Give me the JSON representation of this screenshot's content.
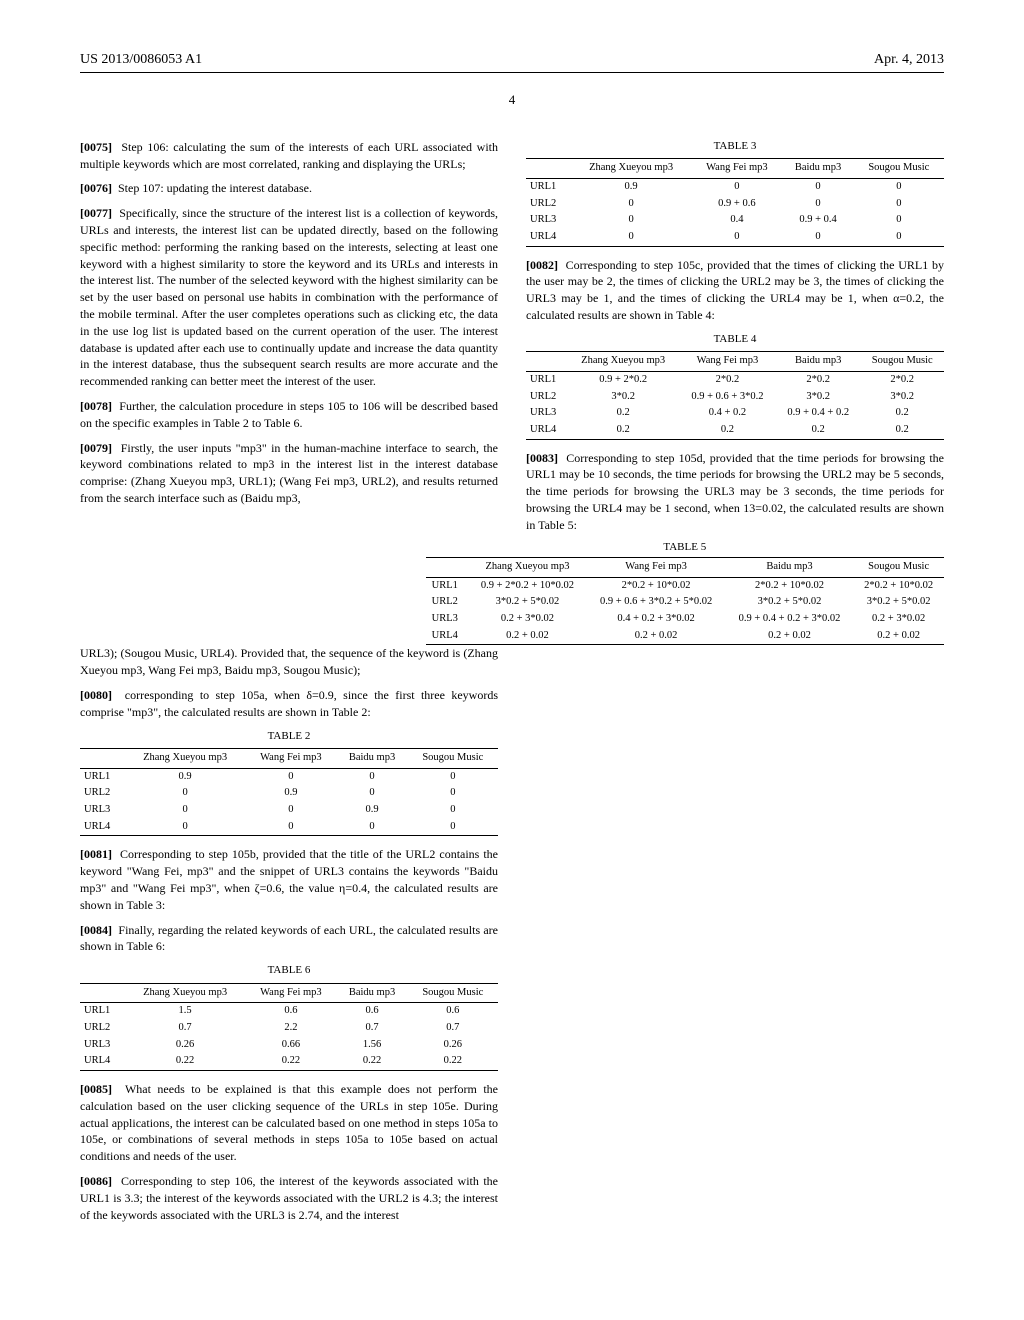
{
  "header": {
    "pubnum": "US 2013/0086053 A1",
    "date": "Apr. 4, 2013",
    "pagenum": "4"
  },
  "paras": {
    "p0075": {
      "num": "[0075]",
      "text": "Step 106: calculating the sum of the interests of each URL associated with multiple keywords which are most correlated, ranking and displaying the URLs;"
    },
    "p0076": {
      "num": "[0076]",
      "text": "Step 107: updating the interest database."
    },
    "p0077": {
      "num": "[0077]",
      "text": "Specifically, since the structure of the interest list is a collection of keywords, URLs and interests, the interest list can be updated directly, based on the following specific method: performing the ranking based on the interests, selecting at least one keyword with a highest similarity to store the keyword and its URLs and interests in the interest list. The number of the selected keyword with the highest similarity can be set by the user based on personal use habits in combination with the performance of the mobile terminal. After the user completes operations such as clicking etc, the data in the use log list is updated based on the current operation of the user. The interest database is updated after each use to continually update and increase the data quantity in the interest database, thus the subsequent search results are more accurate and the recommended ranking can better meet the interest of the user."
    },
    "p0078": {
      "num": "[0078]",
      "text": "Further, the calculation procedure in steps 105 to 106 will be described based on the specific examples in Table 2 to Table 6."
    },
    "p0079": {
      "num": "[0079]",
      "text": "Firstly, the user inputs \"mp3\" in the human-machine interface to search, the keyword combinations related to mp3 in the interest list in the interest database comprise: (Zhang Xueyou mp3, URL1); (Wang Fei mp3, URL2), and results returned from the search interface such as (Baidu mp3,"
    },
    "pCont": {
      "text": "URL3); (Sougou Music, URL4). Provided that, the sequence of the keyword is (Zhang Xueyou mp3, Wang Fei mp3, Baidu mp3, Sougou Music);"
    },
    "p0080": {
      "num": "[0080]",
      "text": "corresponding to step 105a, when δ=0.9, since the first three keywords comprise \"mp3\", the calculated results are shown in Table 2:"
    },
    "p0081": {
      "num": "[0081]",
      "text": "Corresponding to step 105b, provided that the title of the URL2 contains the keyword \"Wang Fei, mp3\" and the snippet of URL3 contains the keywords \"Baidu mp3\" and \"Wang Fei mp3\", when ζ=0.6, the value η=0.4, the calculated results are shown in Table 3:"
    },
    "p0082": {
      "num": "[0082]",
      "text": "Corresponding to step 105c, provided that the times of clicking the URL1 by the user may be 2, the times of clicking the URL2 may be 3, the times of clicking the URL3 may be 1, and the times of clicking the URL4 may be 1, when α=0.2, the calculated results are shown in Table 4:"
    },
    "p0083": {
      "num": "[0083]",
      "text": "Corresponding to step 105d, provided that the time periods for browsing the URL1 may be 10 seconds, the time periods for browsing the URL2 may be 5 seconds, the time periods for browsing the URL3 may be 3 seconds, the time periods for browsing the URL4 may be 1 second, when 13=0.02, the calculated results are shown in Table 5:"
    },
    "p0084": {
      "num": "[0084]",
      "text": "Finally, regarding the related keywords of each URL, the calculated results are shown in Table 6:"
    },
    "p0085": {
      "num": "[0085]",
      "text": "What needs to be explained is that this example does not perform the calculation based on the user clicking sequence of the URLs in step 105e. During actual applications, the interest can be calculated based on one method in steps 105a to 105e, or combinations of several methods in steps 105a to 105e based on actual conditions and needs of the user."
    },
    "p0086": {
      "num": "[0086]",
      "text": "Corresponding to step 106, the interest of the keywords associated with the URL1 is 3.3; the interest of the keywords associated with the URL2 is 4.3; the interest of the keywords associated with the URL3 is 2.74, and the interest"
    }
  },
  "tables": {
    "t2": {
      "caption": "TABLE 2",
      "headers": [
        "",
        "Zhang Xueyou mp3",
        "Wang Fei mp3",
        "Baidu mp3",
        "Sougou Music"
      ],
      "rows": [
        [
          "URL1",
          "0.9",
          "0",
          "0",
          "0"
        ],
        [
          "URL2",
          "0",
          "0.9",
          "0",
          "0"
        ],
        [
          "URL3",
          "0",
          "0",
          "0.9",
          "0"
        ],
        [
          "URL4",
          "0",
          "0",
          "0",
          "0"
        ]
      ]
    },
    "t3": {
      "caption": "TABLE 3",
      "headers": [
        "",
        "Zhang Xueyou mp3",
        "Wang Fei mp3",
        "Baidu mp3",
        "Sougou Music"
      ],
      "rows": [
        [
          "URL1",
          "0.9",
          "0",
          "0",
          "0"
        ],
        [
          "URL2",
          "0",
          "0.9 + 0.6",
          "0",
          "0"
        ],
        [
          "URL3",
          "0",
          "0.4",
          "0.9 + 0.4",
          "0"
        ],
        [
          "URL4",
          "0",
          "0",
          "0",
          "0"
        ]
      ]
    },
    "t4": {
      "caption": "TABLE 4",
      "headers": [
        "",
        "Zhang Xueyou mp3",
        "Wang Fei mp3",
        "Baidu mp3",
        "Sougou Music"
      ],
      "rows": [
        [
          "URL1",
          "0.9 + 2*0.2",
          "2*0.2",
          "2*0.2",
          "2*0.2"
        ],
        [
          "URL2",
          "3*0.2",
          "0.9 + 0.6 + 3*0.2",
          "3*0.2",
          "3*0.2"
        ],
        [
          "URL3",
          "0.2",
          "0.4 + 0.2",
          "0.9 + 0.4 + 0.2",
          "0.2"
        ],
        [
          "URL4",
          "0.2",
          "0.2",
          "0.2",
          "0.2"
        ]
      ]
    },
    "t5": {
      "caption": "TABLE 5",
      "headers": [
        "",
        "Zhang Xueyou mp3",
        "Wang Fei mp3",
        "Baidu mp3",
        "Sougou Music"
      ],
      "rows": [
        [
          "URL1",
          "0.9 + 2*0.2 + 10*0.02",
          "2*0.2 + 10*0.02",
          "2*0.2 + 10*0.02",
          "2*0.2 + 10*0.02"
        ],
        [
          "URL2",
          "3*0.2 + 5*0.02",
          "0.9 + 0.6 + 3*0.2 + 5*0.02",
          "3*0.2 + 5*0.02",
          "3*0.2 + 5*0.02"
        ],
        [
          "URL3",
          "0.2 + 3*0.02",
          "0.4 + 0.2 + 3*0.02",
          "0.9 + 0.4 + 0.2 + 3*0.02",
          "0.2 + 3*0.02"
        ],
        [
          "URL4",
          "0.2 + 0.02",
          "0.2 + 0.02",
          "0.2 + 0.02",
          "0.2 + 0.02"
        ]
      ]
    },
    "t6": {
      "caption": "TABLE 6",
      "headers": [
        "",
        "Zhang Xueyou mp3",
        "Wang Fei mp3",
        "Baidu mp3",
        "Sougou Music"
      ],
      "rows": [
        [
          "URL1",
          "1.5",
          "0.6",
          "0.6",
          "0.6"
        ],
        [
          "URL2",
          "0.7",
          "2.2",
          "0.7",
          "0.7"
        ],
        [
          "URL3",
          "0.26",
          "0.66",
          "1.56",
          "0.26"
        ],
        [
          "URL4",
          "0.22",
          "0.22",
          "0.22",
          "0.22"
        ]
      ]
    }
  },
  "chart_data": [
    {
      "type": "table",
      "title": "TABLE 2",
      "categories": [
        "Zhang Xueyou mp3",
        "Wang Fei mp3",
        "Baidu mp3",
        "Sougou Music"
      ],
      "series": [
        {
          "name": "URL1",
          "values": [
            0.9,
            0,
            0,
            0
          ]
        },
        {
          "name": "URL2",
          "values": [
            0,
            0.9,
            0,
            0
          ]
        },
        {
          "name": "URL3",
          "values": [
            0,
            0,
            0.9,
            0
          ]
        },
        {
          "name": "URL4",
          "values": [
            0,
            0,
            0,
            0
          ]
        }
      ]
    },
    {
      "type": "table",
      "title": "TABLE 6",
      "categories": [
        "Zhang Xueyou mp3",
        "Wang Fei mp3",
        "Baidu mp3",
        "Sougou Music"
      ],
      "series": [
        {
          "name": "URL1",
          "values": [
            1.5,
            0.6,
            0.6,
            0.6
          ]
        },
        {
          "name": "URL2",
          "values": [
            0.7,
            2.2,
            0.7,
            0.7
          ]
        },
        {
          "name": "URL3",
          "values": [
            0.26,
            0.66,
            1.56,
            0.26
          ]
        },
        {
          "name": "URL4",
          "values": [
            0.22,
            0.22,
            0.22,
            0.22
          ]
        }
      ]
    }
  ]
}
